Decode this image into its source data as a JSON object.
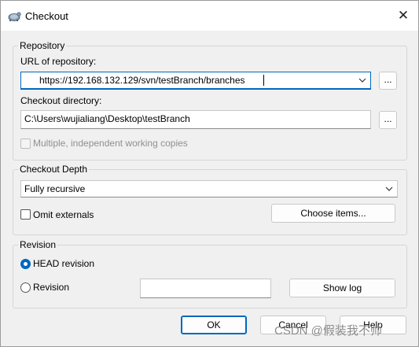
{
  "window": {
    "title": "Checkout",
    "close_glyph": "✕"
  },
  "repository": {
    "group_label": "Repository",
    "url_label": "URL of repository:",
    "url_value": "https://192.168.132.129/svn/testBranch/branches",
    "url_browse": "...",
    "dir_label": "Checkout directory:",
    "dir_value": "C:\\Users\\wujialiang\\Desktop\\testBranch",
    "dir_browse": "...",
    "multiple_copies_label": "Multiple, independent working copies",
    "multiple_copies_checked": false
  },
  "depth": {
    "group_label": "Checkout Depth",
    "selected": "Fully recursive",
    "omit_externals_label": "Omit externals",
    "omit_externals_checked": false,
    "choose_items_button": "Choose items..."
  },
  "revision": {
    "group_label": "Revision",
    "head_label": "HEAD revision",
    "head_selected": true,
    "revision_label": "Revision",
    "revision_value": "",
    "show_log_button": "Show log"
  },
  "footer": {
    "ok": "OK",
    "cancel": "Cancel",
    "help": "Help"
  },
  "watermark": "CSDN @假装我不帅",
  "icons": {
    "app": "tortoise-icon",
    "close": "close-icon",
    "dropdown": "chevron-down-icon"
  },
  "colors": {
    "accent": "#0067c0",
    "background": "#f0f0f0"
  }
}
